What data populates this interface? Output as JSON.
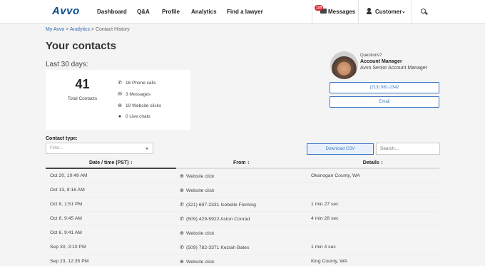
{
  "nav": {
    "logo": "Avvo",
    "links": [
      "Dashboard",
      "Q&A",
      "Profile",
      "Analytics",
      "Find a lawyer"
    ],
    "messages_label": "Messages",
    "messages_badge": "118",
    "customer_label": "Customer",
    "icons": {
      "messages": "envelope-icon",
      "user": "user-icon",
      "search": "search-icon"
    }
  },
  "breadcrumb": {
    "items": [
      "My Avvo",
      "Analytics",
      "Contact History"
    ],
    "separator": ">"
  },
  "page": {
    "title": "Your contacts",
    "period": "Last 30 days:"
  },
  "summary": {
    "total_value": "41",
    "total_label": "Total Contacts",
    "items": [
      {
        "icon": "phone-icon",
        "text": "16 Phone calls"
      },
      {
        "icon": "envelope-icon",
        "text": "3 Messages"
      },
      {
        "icon": "globe-icon",
        "text": "19 Website clicks"
      },
      {
        "icon": "chat-icon",
        "text": "0 Live chats"
      }
    ]
  },
  "account_manager": {
    "question": "Questions?",
    "title": "Account Manager",
    "subtitle": "Avvo Senior Account Manager",
    "phone_button": "(213) 981-2342",
    "email_button": "Email"
  },
  "filters": {
    "contact_type_label": "Contact type:",
    "contact_type_placeholder": "Filter...",
    "download_label": "Download CSV",
    "search_placeholder": "Search..."
  },
  "table": {
    "columns": [
      "Date / time (PST)",
      "From",
      "Details"
    ],
    "rows": [
      {
        "date": "Oct 20, 10:49 AM",
        "type": "web",
        "from": "Website click",
        "details": "Okanogan County, WA"
      },
      {
        "date": "Oct 13, 8:16 AM",
        "type": "web",
        "from": "Website click",
        "details": ""
      },
      {
        "date": "Oct 8, 1:51 PM",
        "type": "phone",
        "from": "(321) 697-2331  Isobelle Fleming",
        "details": "1 min 27 sec"
      },
      {
        "date": "Oct 8, 9:45 AM",
        "type": "phone",
        "from": "(509) 429-5922  Aston Conrad",
        "details": "4 min 28 sec"
      },
      {
        "date": "Oct 6, 9:41 AM",
        "type": "web",
        "from": "Website click",
        "details": ""
      },
      {
        "date": "Sep 30, 3:10 PM",
        "type": "phone",
        "from": "(509) 782-3371  Keziah Bates",
        "details": "1 min 4 sec"
      },
      {
        "date": "Sep 23, 12:35 PM",
        "type": "web",
        "from": "Website click",
        "details": "King County, WA"
      }
    ]
  },
  "colors": {
    "brand": "#0a4d8c",
    "accent": "#3b76c4",
    "badge": "#d9262f"
  }
}
